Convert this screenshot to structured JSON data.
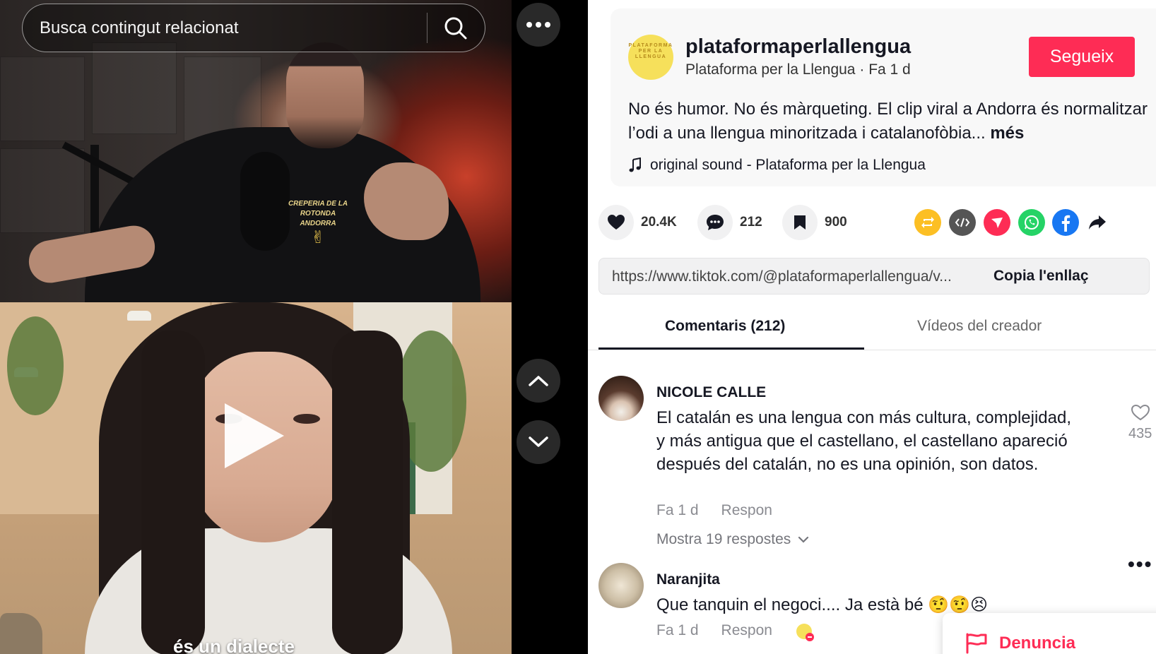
{
  "search": {
    "placeholder": "Busca contingut relacionat"
  },
  "video": {
    "shirt_text_line1": "CREPERIA DE LA ROTONDA",
    "shirt_text_line2": "ANDORRA",
    "subtitle": "és un dialecte"
  },
  "post": {
    "avatar_text": "PLATAFORMA PER LA LLENGUA",
    "username": "plataformaperlallengua",
    "display_name": "Plataforma per la Llengua",
    "separator": "·",
    "time_ago": "Fa 1 d",
    "follow_label": "Segueix",
    "caption": "No és humor. No és màrqueting. El clip viral a Andorra és normalitzar l’odi a una llengua minoritzada i catalanofòbia...",
    "more_label": "més",
    "sound": "original sound - Plataforma per la Llengua"
  },
  "stats": {
    "likes": "20.4K",
    "comments": "212",
    "saves": "900"
  },
  "share_icons": [
    "repost-icon",
    "embed-icon",
    "send-icon",
    "whatsapp-icon",
    "facebook-icon",
    "share-arrow-icon"
  ],
  "link": {
    "url": "https://www.tiktok.com/@plataformaperlallengua/v...",
    "copy_label": "Copia l'enllaç"
  },
  "tabs": {
    "comments": "Comentaris (212)",
    "creator_videos": "Vídeos del creador"
  },
  "comments": [
    {
      "name": "NICOLE CALLE",
      "text": "El catalán es una lengua con más cultura, complejidad, y más antigua que el castellano, el castellano apareció después del catalán, no es una opinión, son datos.",
      "time": "Fa 1 d",
      "reply_label": "Respon",
      "replies_label": "Mostra 19 respostes",
      "likes": "435"
    },
    {
      "name": "Naranjita",
      "text": "Que tanquin el negoci.... Ja està bé 🤨🤨😣",
      "time": "Fa 1 d",
      "reply_label": "Respon"
    }
  ],
  "report": {
    "label": "Denuncia"
  },
  "colors": {
    "accent": "#fe2c55",
    "repost": "#fcbf24",
    "embed": "#555555",
    "send": "#fe2c55",
    "whatsapp": "#25d366",
    "facebook": "#1877f2"
  }
}
